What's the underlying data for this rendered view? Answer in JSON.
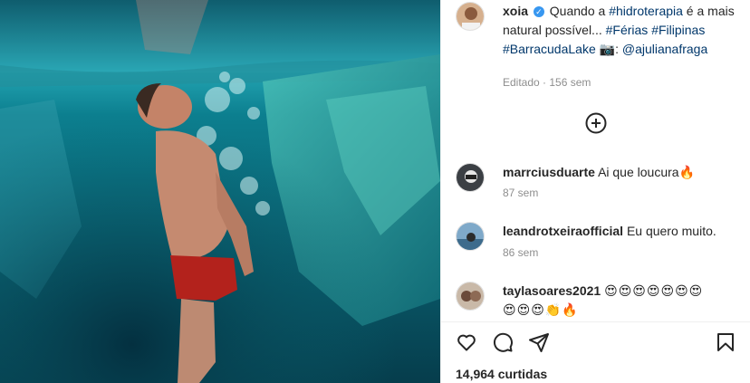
{
  "post": {
    "author": "xoia",
    "caption_pre": "Quando a ",
    "caption_tag1": "#hidroterapia",
    "caption_mid": " é a mais natural possível... ",
    "caption_tag2": "#Férias",
    "caption_tag3": "#Filipinas",
    "caption_tag4": "#BarracudaLake",
    "caption_camera": "📷",
    "caption_colon": ":",
    "caption_mention": "@ajulianafraga",
    "edited_label": "Editado",
    "time_ago": "156 sem"
  },
  "comments": [
    {
      "user": "marrciusduarte",
      "text": "Ai que loucura",
      "emoji": "🔥",
      "time": "87 sem"
    },
    {
      "user": "leandrotxeiraofficial",
      "text": "Eu quero muito.",
      "time": "86 sem"
    },
    {
      "user": "taylasoares2021",
      "emoji_line1": "😍😍😍😍😍😍😍",
      "emoji_line2": "😍😍😍👏🔥"
    }
  ],
  "likes": "14,964 curtidas",
  "icons": {
    "verified": "verified-badge-icon",
    "load_more": "plus-circle-icon",
    "like": "heart-icon",
    "comment": "comment-bubble-icon",
    "share": "paper-plane-icon",
    "save": "bookmark-icon"
  },
  "colors": {
    "link": "#00376b",
    "muted": "#8e8e8e",
    "verified": "#3897f0"
  }
}
